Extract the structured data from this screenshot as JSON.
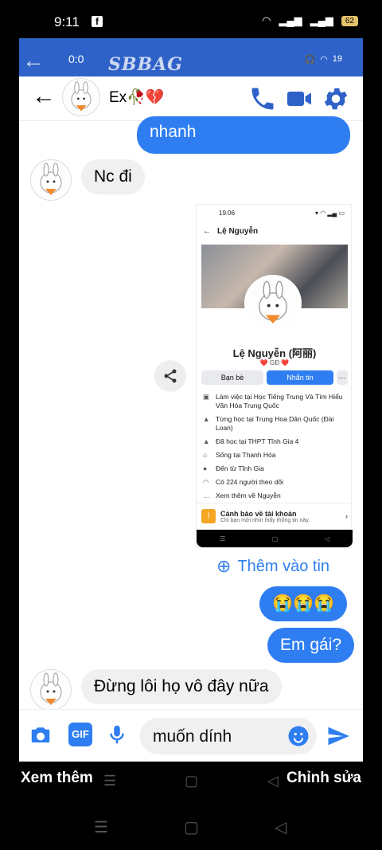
{
  "outer_status": {
    "time": "9:11",
    "battery": "62"
  },
  "inner_status": {
    "time": "0:0",
    "brand": "SBBAG",
    "battery": "19"
  },
  "header": {
    "contact_name": "Ex🥀💔"
  },
  "messages": [
    {
      "dir": "out",
      "text": "nhanh"
    },
    {
      "dir": "in",
      "text": "Nc đi"
    },
    {
      "dir": "out",
      "text": "😭😭😭"
    },
    {
      "dir": "out",
      "text": "Em gái?"
    },
    {
      "dir": "in",
      "text": "Đừng lôi họ vô đây nữa"
    }
  ],
  "profile_card": {
    "time": "19:06",
    "header_name": "Lệ Nguyễn",
    "name": "Lệ Nguyễn (阿丽)",
    "sub": "❤️ GĐ ❤️",
    "btn_friends": "Bạn bè",
    "btn_message": "Nhắn tin",
    "btn_more": "···",
    "info": [
      "Làm việc tại Học Tiếng Trung Và Tìm Hiểu Văn Hóa Trung Quốc",
      "Từng học tại Trung Hoa Dân Quốc (Đài Loan)",
      "Đã học tại THPT Tĩnh Gia 4",
      "Sống tại Thanh Hóa",
      "Đến từ Tĩnh Gia",
      "Có 224 người theo dõi",
      "Xem thêm về Nguyễn"
    ],
    "warn_title": "Cảnh báo về tài khoản",
    "warn_sub": "Chỉ bạn mới nhìn thấy thông tin này."
  },
  "add_story": "Thêm vào tin",
  "composer": {
    "input_value": "muốn dính",
    "gif": "GIF"
  },
  "bottom": {
    "left": "Xem thêm",
    "right": "Chỉnh sửa"
  },
  "colors": {
    "accent": "#2f7ef1",
    "header_blue": "#2f62c8"
  }
}
